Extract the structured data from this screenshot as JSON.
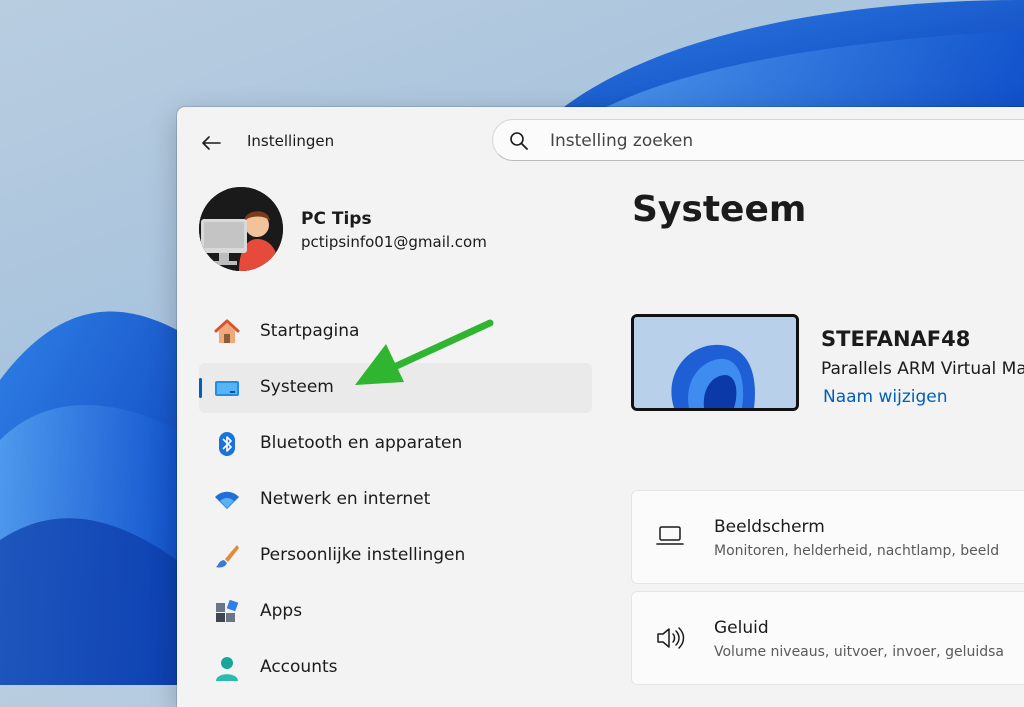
{
  "app": {
    "title": "Instellingen"
  },
  "search": {
    "placeholder": "Instelling zoeken"
  },
  "profile": {
    "name": "PC Tips",
    "email": "pctipsinfo01@gmail.com"
  },
  "nav": {
    "items": [
      {
        "label": "Startpagina",
        "icon": "home-icon",
        "selected": false
      },
      {
        "label": "Systeem",
        "icon": "display-icon",
        "selected": true
      },
      {
        "label": "Bluetooth en apparaten",
        "icon": "bluetooth-icon",
        "selected": false
      },
      {
        "label": "Netwerk en internet",
        "icon": "wifi-icon",
        "selected": false
      },
      {
        "label": "Persoonlijke instellingen",
        "icon": "paintbrush-icon",
        "selected": false
      },
      {
        "label": "Apps",
        "icon": "apps-icon",
        "selected": false
      },
      {
        "label": "Accounts",
        "icon": "person-icon",
        "selected": false
      }
    ]
  },
  "main": {
    "title": "Systeem",
    "device": {
      "name": "STEFANAF48",
      "model": "Parallels ARM Virtual Ma",
      "rename_label": "Naam wijzigen"
    },
    "cards": [
      {
        "title": "Beeldscherm",
        "subtitle": "Monitoren, helderheid, nachtlamp, beeld",
        "icon": "laptop-icon"
      },
      {
        "title": "Geluid",
        "subtitle": "Volume niveaus, uitvoer, invoer, geluidsa",
        "icon": "speaker-icon"
      }
    ]
  },
  "colors": {
    "accent": "#005fb8",
    "annotation_arrow": "#2fb52f"
  }
}
